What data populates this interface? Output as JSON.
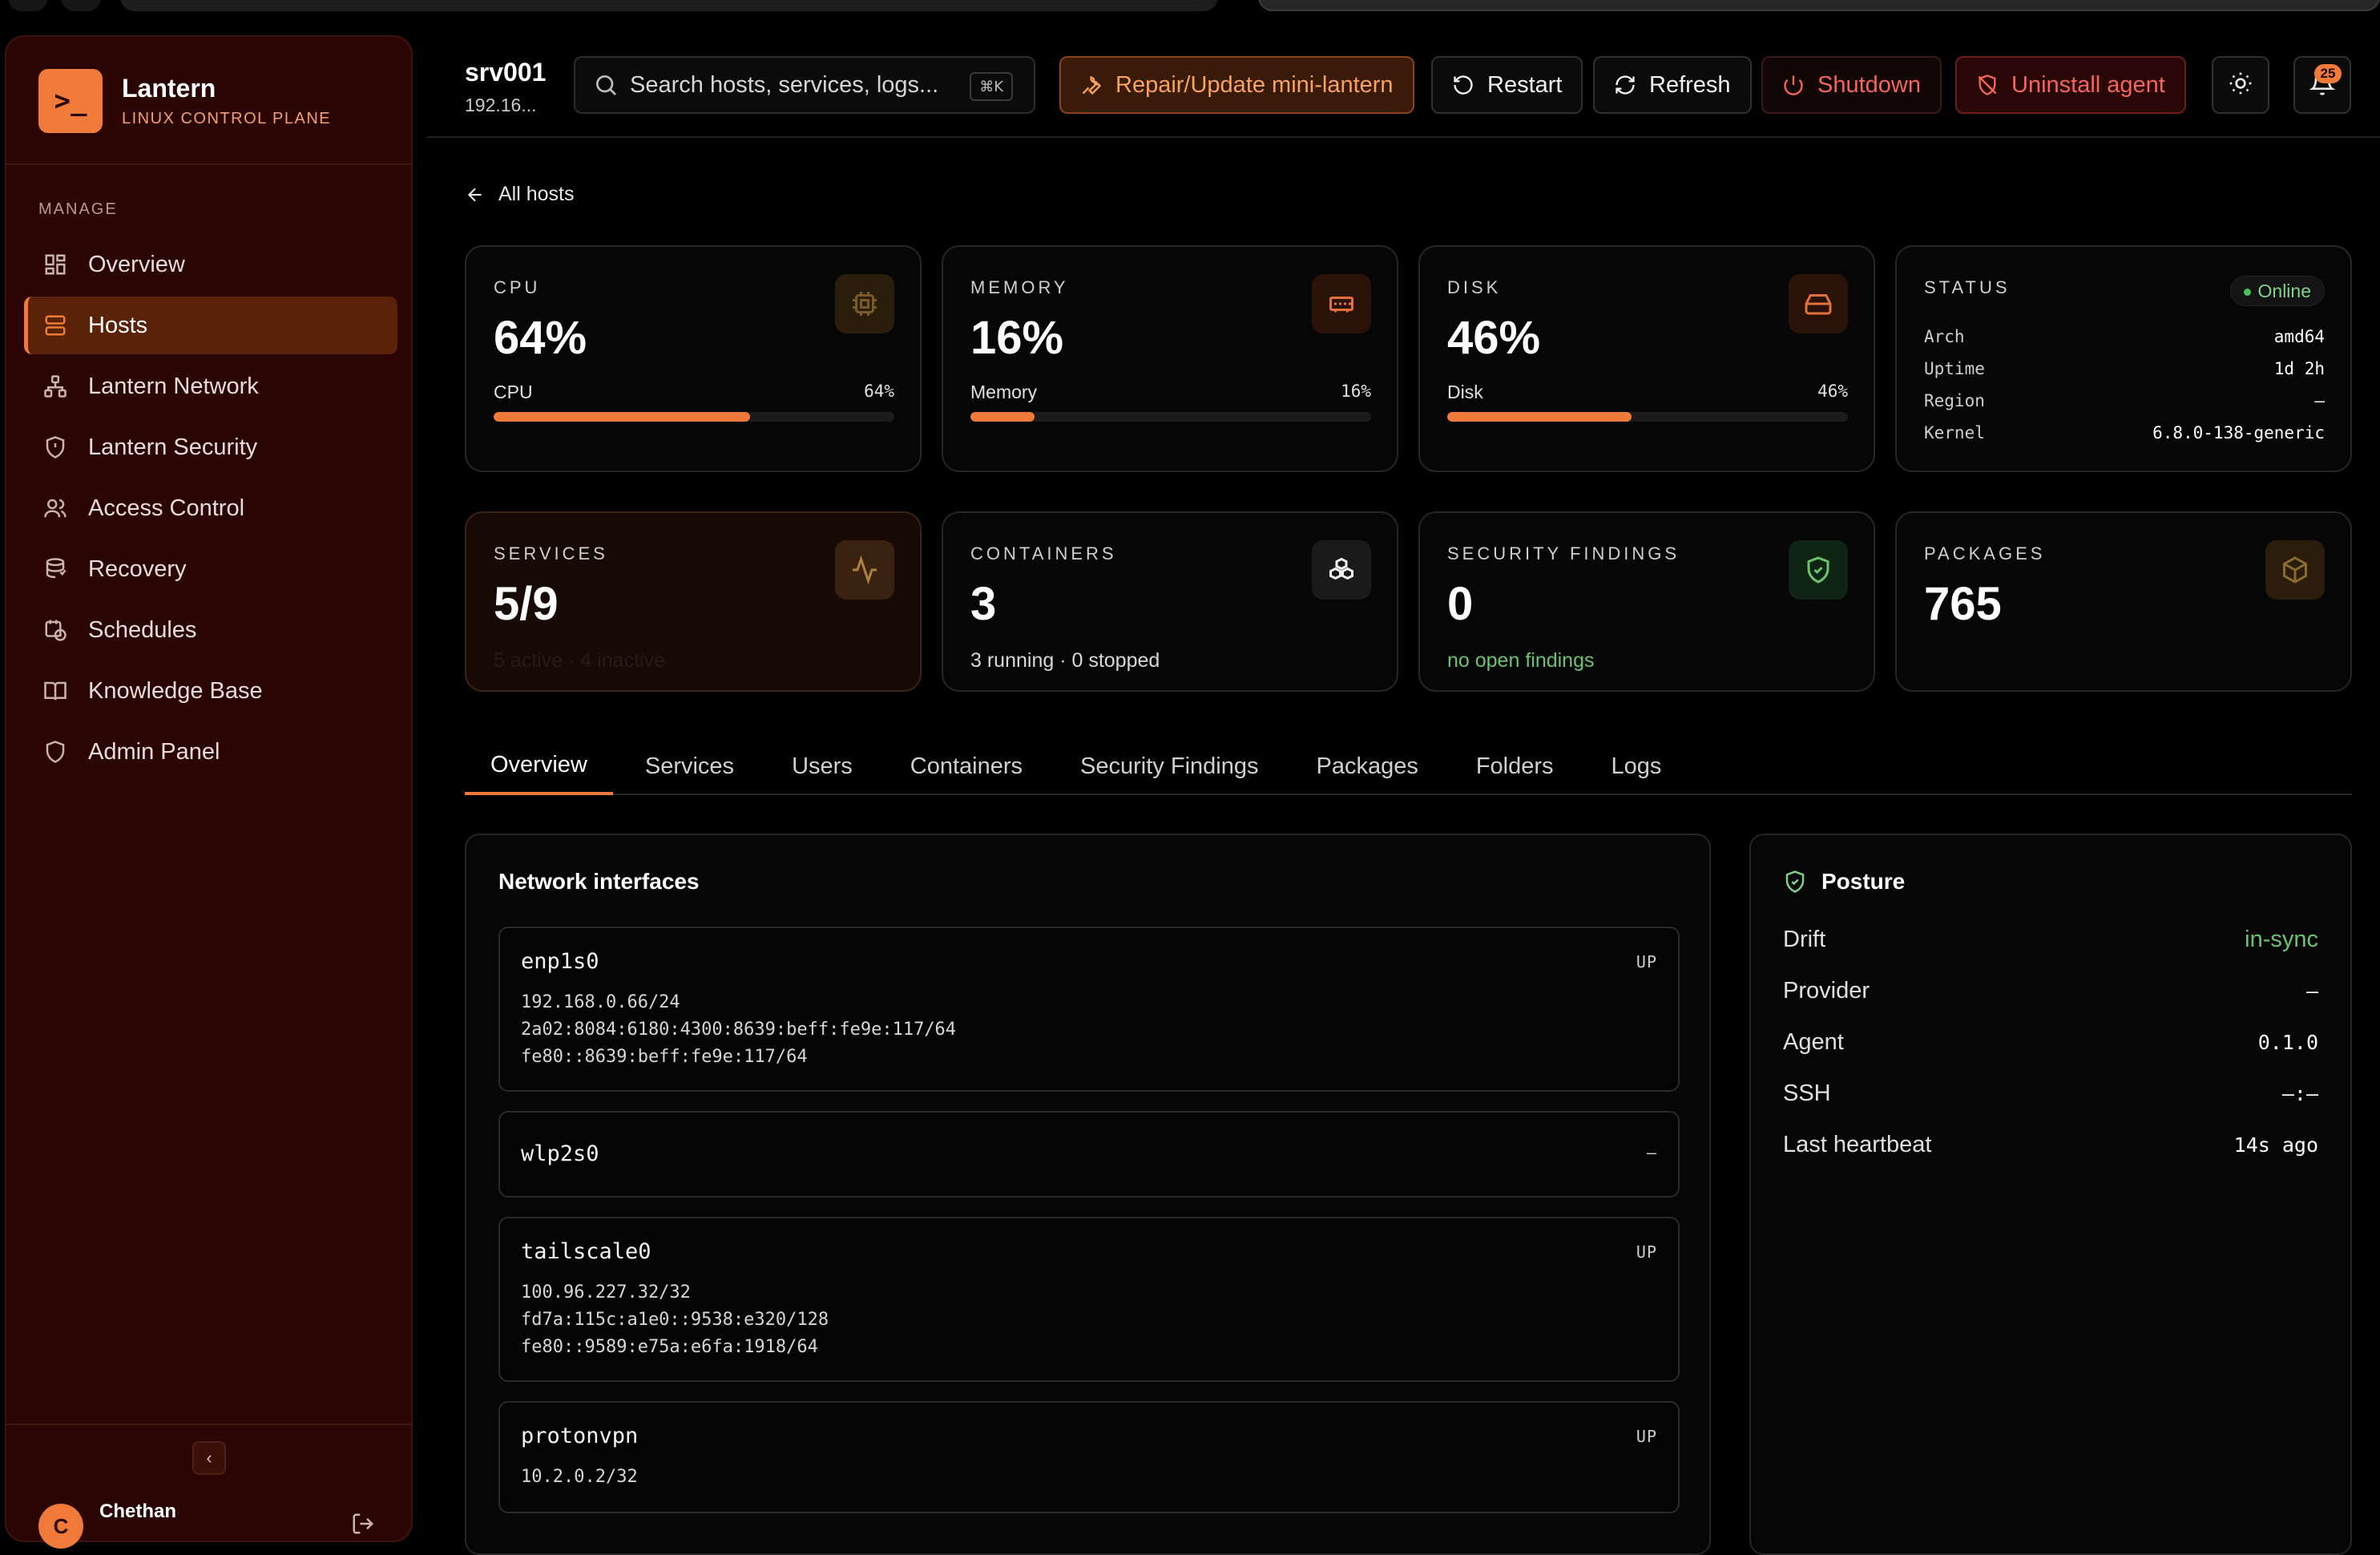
{
  "sidebar": {
    "brand_name": "Lantern",
    "brand_sub": "LINUX CONTROL PLANE",
    "section": "MANAGE",
    "items": [
      {
        "label": "Overview",
        "icon": "dashboard-icon"
      },
      {
        "label": "Hosts",
        "icon": "server-icon"
      },
      {
        "label": "Lantern Network",
        "icon": "network-icon"
      },
      {
        "label": "Lantern Security",
        "icon": "shield-icon"
      },
      {
        "label": "Access Control",
        "icon": "users-icon"
      },
      {
        "label": "Recovery",
        "icon": "database-icon"
      },
      {
        "label": "Schedules",
        "icon": "calendar-clock-icon"
      },
      {
        "label": "Knowledge Base",
        "icon": "book-icon"
      },
      {
        "label": "Admin Panel",
        "icon": "shield-icon"
      }
    ],
    "active_item": "Hosts",
    "user_name": "Chethan",
    "user_initial": "C"
  },
  "header": {
    "host_name": "srv001",
    "host_ip": "192.16...",
    "search_placeholder": "Search hosts, services, logs...",
    "search_shortcut": "⌘K",
    "buttons": {
      "repair": "Repair/Update mini-lantern",
      "restart": "Restart",
      "refresh": "Refresh",
      "shutdown": "Shutdown",
      "uninstall": "Uninstall agent"
    },
    "notification_count": "25"
  },
  "back_link": "All hosts",
  "stats": {
    "cpu": {
      "label": "CPU",
      "value": "64%",
      "bar_label": "CPU",
      "bar_pct": "64%",
      "level": 0.64
    },
    "memory": {
      "label": "MEMORY",
      "value": "16%",
      "bar_label": "Memory",
      "bar_pct": "16%",
      "level": 0.16
    },
    "disk": {
      "label": "DISK",
      "value": "46%",
      "bar_label": "Disk",
      "bar_pct": "46%",
      "level": 0.46
    },
    "status": {
      "label": "STATUS",
      "badge": "Online",
      "rows": [
        {
          "k": "Arch",
          "v": "amd64"
        },
        {
          "k": "Uptime",
          "v": "1d 2h"
        },
        {
          "k": "Region",
          "v": "—"
        },
        {
          "k": "Kernel",
          "v": "6.8.0-138-generic"
        }
      ]
    },
    "services": {
      "label": "SERVICES",
      "value": "5/9",
      "sub": "5 active · 4 inactive"
    },
    "containers": {
      "label": "CONTAINERS",
      "value": "3",
      "sub": "3 running · 0 stopped"
    },
    "security": {
      "label": "SECURITY FINDINGS",
      "value": "0",
      "sub": "no open findings"
    },
    "packages": {
      "label": "PACKAGES",
      "value": "765"
    }
  },
  "tabs": [
    "Overview",
    "Services",
    "Users",
    "Containers",
    "Security Findings",
    "Packages",
    "Folders",
    "Logs"
  ],
  "active_tab": "Overview",
  "network": {
    "title": "Network interfaces",
    "interfaces": [
      {
        "name": "enp1s0",
        "state": "UP",
        "addrs": [
          "192.168.0.66/24",
          "2a02:8084:6180:4300:8639:beff:fe9e:117/64",
          "fe80::8639:beff:fe9e:117/64"
        ]
      },
      {
        "name": "wlp2s0",
        "state": "—",
        "addrs": []
      },
      {
        "name": "tailscale0",
        "state": "UP",
        "addrs": [
          "100.96.227.32/32",
          "fd7a:115c:a1e0::9538:e320/128",
          "fe80::9589:e75a:e6fa:1918/64"
        ]
      },
      {
        "name": "protonvpn",
        "state": "UP",
        "addrs": [
          "10.2.0.2/32"
        ]
      }
    ]
  },
  "posture": {
    "title": "Posture",
    "rows": [
      {
        "k": "Drift",
        "v": "in-sync"
      },
      {
        "k": "Provider",
        "v": "—"
      },
      {
        "k": "Agent",
        "v": "0.1.0"
      },
      {
        "k": "SSH",
        "v": "—:—"
      },
      {
        "k": "Last heartbeat",
        "v": "14s ago"
      }
    ]
  },
  "colors": {
    "accent": "#f07a3a",
    "sidebar_bg": "#2a0503",
    "danger": "#f4655a",
    "success": "#6cc36f"
  }
}
